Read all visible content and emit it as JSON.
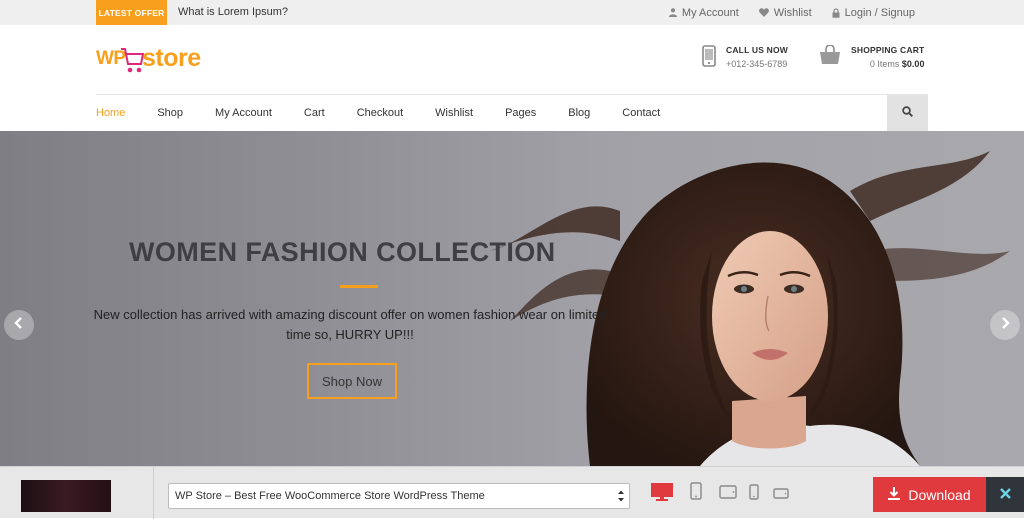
{
  "topbar": {
    "offer_label": "LATEST OFFER",
    "offer_text": "What is Lorem Ipsum?",
    "links": [
      {
        "label": "My Account",
        "icon": "user-icon"
      },
      {
        "label": "Wishlist",
        "icon": "heart-icon"
      },
      {
        "label": "Login / Signup",
        "icon": "lock-icon"
      }
    ]
  },
  "header": {
    "logo_wp": "WP",
    "logo_store": "store",
    "call": {
      "title": "CALL US NOW",
      "phone": "+012-345-6789"
    },
    "cart": {
      "title": "SHOPPING CART",
      "items": "0 Items",
      "total": "$0.00"
    }
  },
  "nav": {
    "items": [
      "Home",
      "Shop",
      "My Account",
      "Cart",
      "Checkout",
      "Wishlist",
      "Pages",
      "Blog",
      "Contact"
    ],
    "active": "Home"
  },
  "hero": {
    "title": "WOMEN FASHION COLLECTION",
    "description": "New collection has arrived with amazing discount offer on women fashion wear on limited time so, HURRY UP!!!",
    "button": "Shop Now"
  },
  "preview_bar": {
    "theme_select": "WP Store – Best Free WooCommerce Store WordPress Theme",
    "download": "Download",
    "devices": [
      "desktop-icon",
      "tablet-portrait-icon",
      "tablet-landscape-icon",
      "phone-portrait-icon",
      "phone-landscape-icon"
    ]
  },
  "colors": {
    "accent": "#f8a01e",
    "download": "#e03a3e",
    "close": "#30353b"
  }
}
